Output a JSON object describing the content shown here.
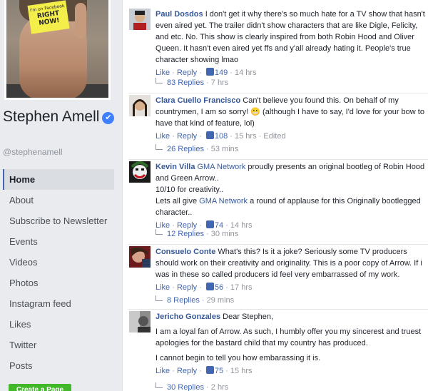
{
  "profile": {
    "note_line1": "I'm on Facebook",
    "note_line2": "RIGHT NOW!",
    "name": "Stephen Amell",
    "verified_glyph": "✔",
    "username": "@stephenamell"
  },
  "nav": {
    "items": [
      {
        "label": "Home"
      },
      {
        "label": "About"
      },
      {
        "label": "Subscribe to Newsletter"
      },
      {
        "label": "Events"
      },
      {
        "label": "Videos"
      },
      {
        "label": "Photos"
      },
      {
        "label": "Instagram feed"
      },
      {
        "label": "Likes"
      },
      {
        "label": "Twitter"
      },
      {
        "label": "Posts"
      }
    ],
    "create_page": "Create a Page"
  },
  "comments": [
    {
      "author": "Paul Dosdos",
      "text": "I don't get it why there's so much hate for a TV show that hasn't even aired yet. The trailer didn't show characters that are like Digle, Felicity, and etc. No. This show is clearly inspired from both Robin Hood and Oliver Queen. It hasn't even aired yet ffs and y'all already hating it. People's true character showing lmao",
      "like": "Like",
      "reply": "Reply",
      "likes": "149",
      "time": "14 hrs",
      "replies": "83 Replies",
      "replies_time": "7 hrs"
    },
    {
      "author": "Clara Cuello Francisco",
      "text_a": "Can't believe you found this. On behalf of my countrymen, I am so sorry!",
      "emoji": "😬",
      "text_b": "(although I have to say, I'd love for your bow to have that kind of feature, lol)",
      "like": "Like",
      "reply": "Reply",
      "likes": "108",
      "time": "15 hrs",
      "edited": "Edited",
      "replies": "26 Replies",
      "replies_time": "53 mins"
    },
    {
      "author": "Kevin Villa",
      "link1": "GMA Network",
      "text_a": "proudly presents an original bootleg of Robin Hood and Green Arrow..",
      "text_b": "10/10 for creativity..",
      "text_c": "Lets all give",
      "link2": "GMA Network",
      "text_d": "a round of applause for this Originally bootlegged character..",
      "like": "Like",
      "reply": "Reply",
      "likes": "74",
      "time": "14 hrs",
      "replies": "12 Replies",
      "replies_time": "30 mins"
    },
    {
      "author": "Consuelo Conte",
      "text": "What's this? Is it a joke? Seriously some TV producers should work on their creativity and originality. This is a poor copy of Arrow. If i was in these so called producers id feel very embarrassed of my work.",
      "like": "Like",
      "reply": "Reply",
      "likes": "56",
      "time": "17 hrs",
      "replies": "8 Replies",
      "replies_time": "29 mins"
    },
    {
      "author": "Jericho Gonzales",
      "text_a": "Dear Stephen,",
      "text_b": "I am a loyal fan of Arrow. As such, I humbly offer you my sincerest and truest apologies for the bastard child that my country has produced.",
      "text_c": "I cannot begin to tell you how embarassing it is.",
      "like": "Like",
      "reply": "Reply",
      "likes": "75",
      "time": "15 hrs",
      "replies": "30 Replies",
      "replies_time": "2 hrs"
    }
  ],
  "sep": " · ",
  "colors": {
    "link": "#365899",
    "action": "#4267b2",
    "meta": "#90949c",
    "active_border": "#4267b2",
    "create_button": "#42b72a"
  }
}
